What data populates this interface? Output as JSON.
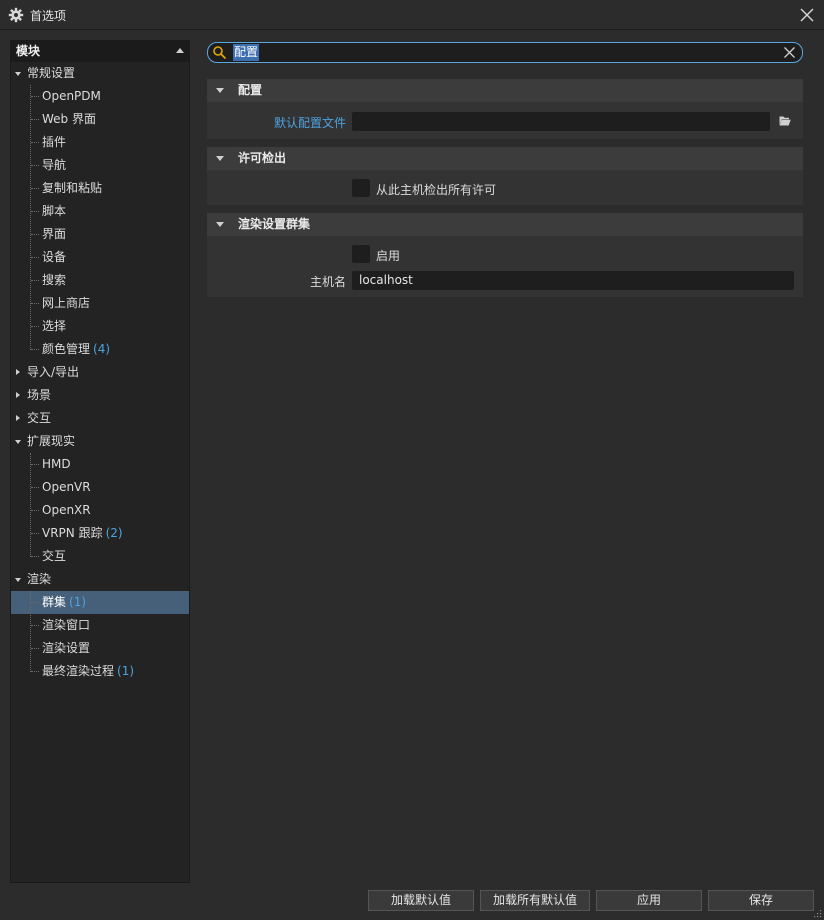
{
  "window": {
    "title": "首选项"
  },
  "tree": {
    "header": "模块",
    "items": [
      {
        "label": "常规设置",
        "level": 0,
        "expanded": true
      },
      {
        "label": "OpenPDM",
        "level": 1
      },
      {
        "label": "Web 界面",
        "level": 1
      },
      {
        "label": "插件",
        "level": 1
      },
      {
        "label": "导航",
        "level": 1
      },
      {
        "label": "复制和粘贴",
        "level": 1
      },
      {
        "label": "脚本",
        "level": 1
      },
      {
        "label": "界面",
        "level": 1
      },
      {
        "label": "设备",
        "level": 1
      },
      {
        "label": "搜索",
        "level": 1
      },
      {
        "label": "网上商店",
        "level": 1
      },
      {
        "label": "选择",
        "level": 1
      },
      {
        "label": "颜色管理",
        "count": "(4)",
        "level": 1
      },
      {
        "label": "导入/导出",
        "level": 0,
        "expanded": false
      },
      {
        "label": "场景",
        "level": 0,
        "expanded": false
      },
      {
        "label": "交互",
        "level": 0,
        "expanded": false
      },
      {
        "label": "扩展现实",
        "level": 0,
        "expanded": true
      },
      {
        "label": "HMD",
        "level": 1
      },
      {
        "label": "OpenVR",
        "level": 1
      },
      {
        "label": "OpenXR",
        "level": 1
      },
      {
        "label": "VRPN 跟踪",
        "count": "(2)",
        "level": 1
      },
      {
        "label": "交互",
        "level": 1
      },
      {
        "label": "渲染",
        "level": 0,
        "expanded": true
      },
      {
        "label": "群集",
        "count": "(1)",
        "level": 1,
        "selected": true
      },
      {
        "label": "渲染窗口",
        "level": 1
      },
      {
        "label": "渲染设置",
        "level": 1
      },
      {
        "label": "最终渲染过程",
        "count": "(1)",
        "level": 1
      }
    ]
  },
  "search": {
    "value": "配置"
  },
  "sections": {
    "config": {
      "title": "配置",
      "default_config_label": "默认配置文件",
      "default_config_value": ""
    },
    "license": {
      "title": "许可检出",
      "checkout_label": "从此主机检出所有许可"
    },
    "render_cluster": {
      "title": "渲染设置群集",
      "enable_label": "启用",
      "host_label": "主机名",
      "host_value": "localhost"
    }
  },
  "buttons": {
    "load_defaults": "加载默认值",
    "load_all_defaults": "加载所有默认值",
    "apply": "应用",
    "save": "保存"
  }
}
